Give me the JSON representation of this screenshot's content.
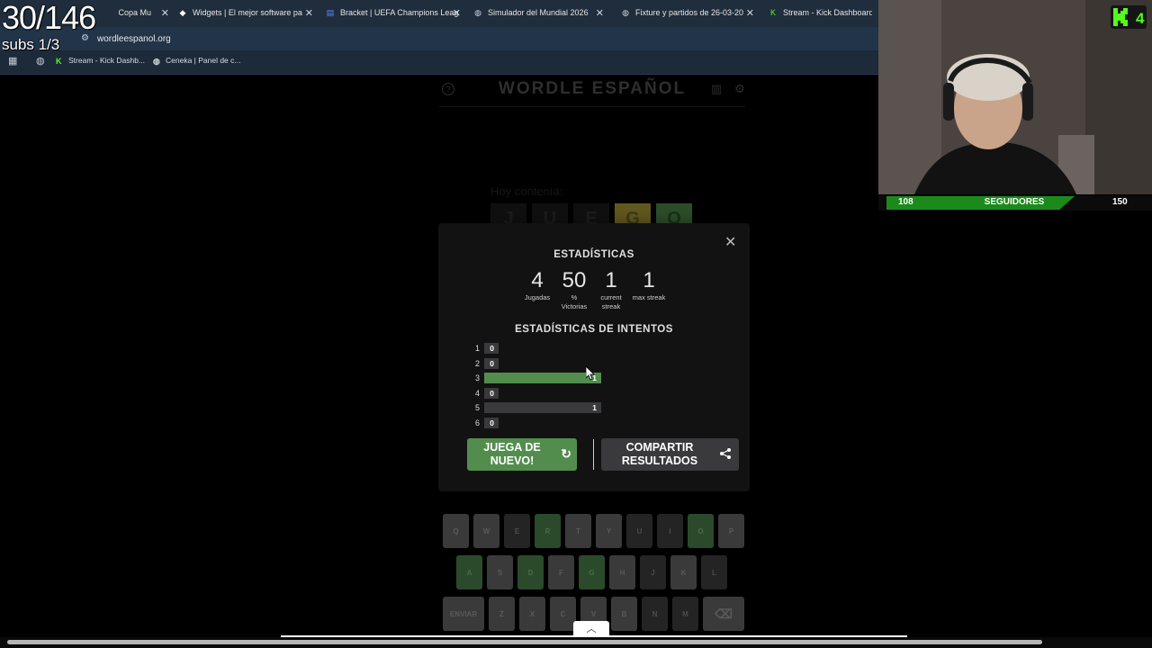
{
  "overlay": {
    "counter": "30/146",
    "subs": "subs 1/3"
  },
  "browser": {
    "tabs": [
      {
        "title": "Copa Mu",
        "icon": "globe-icon"
      },
      {
        "title": "Widgets | El mejor software pa",
        "icon": "diamond-icon"
      },
      {
        "title": "Bracket | UEFA Champions Leag",
        "icon": "document-icon"
      },
      {
        "title": "Simulador del Mundial 2026",
        "icon": "globe-icon"
      },
      {
        "title": "Fixture y partidos de 26-03-20",
        "icon": "globe-icon"
      },
      {
        "title": "Stream - Kick Dashboard",
        "icon": "kick-icon"
      }
    ],
    "url": "wordleespanol.org",
    "bookmarks": [
      {
        "title": "Stream - Kick Dashb...",
        "icon": "kick-icon"
      },
      {
        "title": "Ceneka | Panel de c...",
        "icon": "globe-icon"
      }
    ]
  },
  "game": {
    "title": "WORDLE ESPAÑOL",
    "hint": "Hoy contenía:",
    "bg_tiles": [
      "J",
      "U",
      "E",
      "G",
      "O"
    ],
    "bg_tile_colors": [
      "#1e1e1e",
      "#1e1e1e",
      "#1e1e1e",
      "#b59f3b",
      "#538d4e"
    ]
  },
  "modal": {
    "title": "ESTADÍSTICAS",
    "stats": [
      {
        "value": "4",
        "label": "Jugadas"
      },
      {
        "value": "50",
        "label": "% Victorias"
      },
      {
        "value": "1",
        "label": "current streak"
      },
      {
        "value": "1",
        "label": "max streak"
      }
    ],
    "guess_title": "ESTADÍSTICAS DE INTENTOS",
    "distribution": [
      {
        "guess": "1",
        "count": "0",
        "highlight": false
      },
      {
        "guess": "2",
        "count": "0",
        "highlight": false
      },
      {
        "guess": "3",
        "count": "1",
        "highlight": true
      },
      {
        "guess": "4",
        "count": "0",
        "highlight": false
      },
      {
        "guess": "5",
        "count": "1",
        "highlight": false
      },
      {
        "guess": "6",
        "count": "0",
        "highlight": false
      }
    ],
    "play_again": "JUEGA DE NUEVO!",
    "share": "COMPARTIR RESULTADOS",
    "colors": {
      "correct": "#538d4e",
      "bar": "#3a3a3c"
    }
  },
  "keyboard": {
    "rows": [
      [
        [
          "Q",
          "l"
        ],
        [
          "W",
          "l"
        ],
        [
          "E",
          "d"
        ],
        [
          "R",
          "g"
        ],
        [
          "T",
          "l"
        ],
        [
          "Y",
          "l"
        ],
        [
          "U",
          "d"
        ],
        [
          "I",
          "d"
        ],
        [
          "O",
          "g"
        ],
        [
          "P",
          "l"
        ]
      ],
      [
        [
          "A",
          "g"
        ],
        [
          "S",
          "l"
        ],
        [
          "D",
          "g"
        ],
        [
          "F",
          "l"
        ],
        [
          "G",
          "g"
        ],
        [
          "H",
          "l"
        ],
        [
          "J",
          "d"
        ],
        [
          "K",
          "l"
        ],
        [
          "L",
          "d"
        ]
      ],
      [
        [
          "ENVIAR",
          "l"
        ],
        [
          "Z",
          "l"
        ],
        [
          "X",
          "l"
        ],
        [
          "C",
          "l"
        ],
        [
          "V",
          "l"
        ],
        [
          "B",
          "l"
        ],
        [
          "N",
          "d"
        ],
        [
          "M",
          "d"
        ],
        [
          "⌫",
          "l"
        ]
      ]
    ]
  },
  "follow_goal": {
    "current": "108",
    "label": "SEGUIDORES",
    "goal": "150",
    "color": "#1b8a1b"
  },
  "kick_badge": "4"
}
